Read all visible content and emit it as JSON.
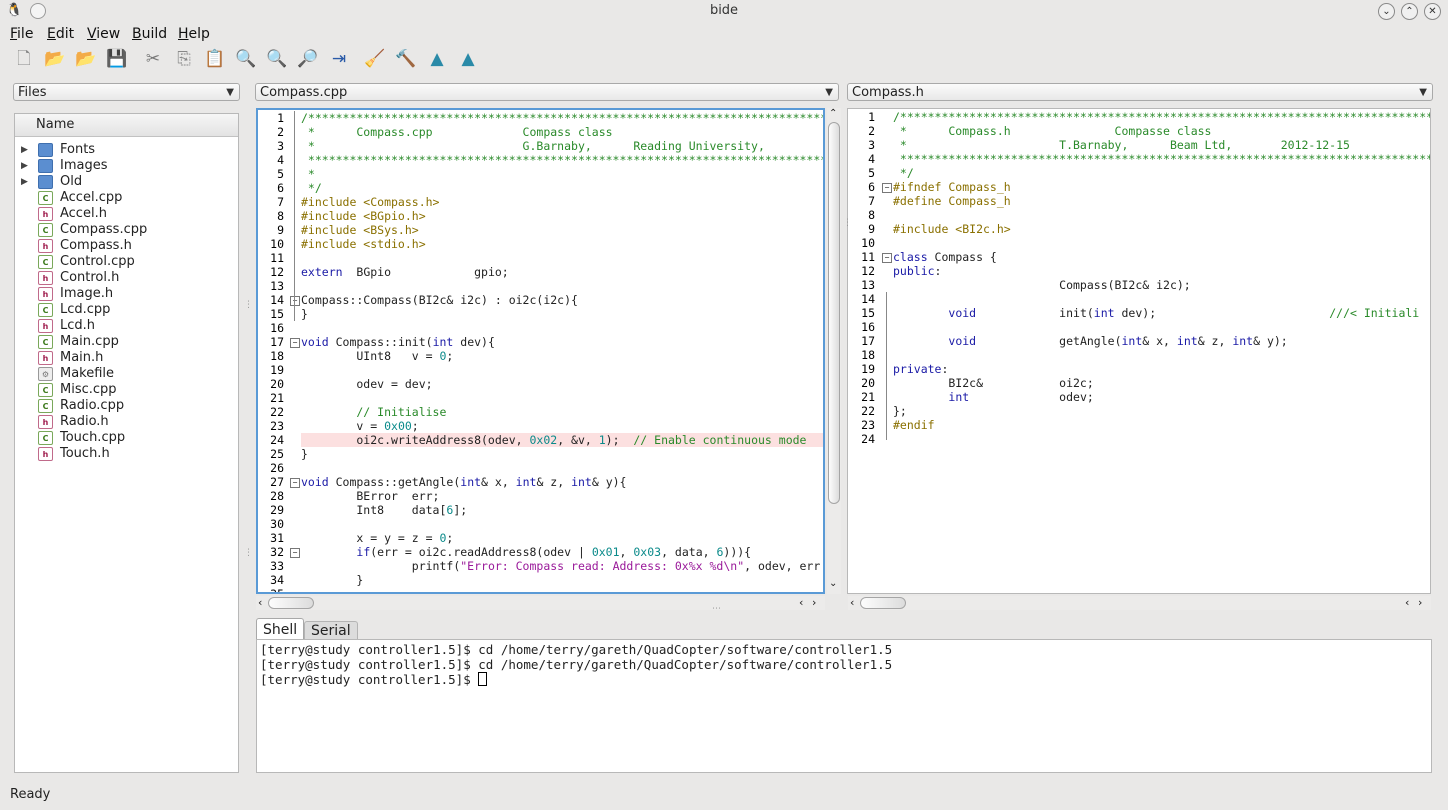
{
  "window": {
    "title": "bide"
  },
  "menu": [
    {
      "label": "File",
      "underline": "F",
      "rest": "ile"
    },
    {
      "label": "Edit",
      "underline": "E",
      "rest": "dit"
    },
    {
      "label": "View",
      "underline": "V",
      "rest": "iew"
    },
    {
      "label": "Build",
      "underline": "B",
      "rest": "uild"
    },
    {
      "label": "Help",
      "underline": "H",
      "rest": "elp"
    }
  ],
  "toolbar": [
    {
      "name": "new-file-icon",
      "glyph": "🗋"
    },
    {
      "name": "open-file-icon",
      "glyph": "📂"
    },
    {
      "name": "open-project-icon",
      "glyph": "📂"
    },
    {
      "name": "save-icon",
      "glyph": "💾"
    },
    {
      "name": "cut-icon",
      "glyph": "✂"
    },
    {
      "name": "copy-icon",
      "glyph": "⎘"
    },
    {
      "name": "paste-icon",
      "glyph": "📋"
    },
    {
      "name": "find-icon",
      "glyph": "🔍"
    },
    {
      "name": "find-next-icon",
      "glyph": "🔍"
    },
    {
      "name": "replace-icon",
      "glyph": "🔎"
    },
    {
      "name": "goto-line-icon",
      "glyph": "⇥"
    },
    {
      "name": "clean-icon",
      "glyph": "🧹"
    },
    {
      "name": "build-icon",
      "glyph": "🔨"
    },
    {
      "name": "flash-icon",
      "glyph": "▲"
    },
    {
      "name": "flash-run-icon",
      "glyph": "▲"
    }
  ],
  "sidebar": {
    "combo_label": "Files",
    "header": "Name",
    "items": [
      {
        "label": "Fonts",
        "type": "folder"
      },
      {
        "label": "Images",
        "type": "folder"
      },
      {
        "label": "Old",
        "type": "folder"
      },
      {
        "label": "Accel.cpp",
        "type": "cpp"
      },
      {
        "label": "Accel.h",
        "type": "h"
      },
      {
        "label": "Compass.cpp",
        "type": "cpp"
      },
      {
        "label": "Compass.h",
        "type": "h"
      },
      {
        "label": "Control.cpp",
        "type": "cpp"
      },
      {
        "label": "Control.h",
        "type": "h"
      },
      {
        "label": "Image.h",
        "type": "h"
      },
      {
        "label": "Lcd.cpp",
        "type": "cpp"
      },
      {
        "label": "Lcd.h",
        "type": "h"
      },
      {
        "label": "Main.cpp",
        "type": "cpp"
      },
      {
        "label": "Main.h",
        "type": "h"
      },
      {
        "label": "Makefile",
        "type": "mk"
      },
      {
        "label": "Misc.cpp",
        "type": "cpp"
      },
      {
        "label": "Radio.cpp",
        "type": "cpp"
      },
      {
        "label": "Radio.h",
        "type": "h"
      },
      {
        "label": "Touch.cpp",
        "type": "cpp"
      },
      {
        "label": "Touch.h",
        "type": "h"
      }
    ]
  },
  "editor_left": {
    "file_label": "Compass.cpp",
    "highlight_line": 24,
    "lines": [
      {
        "n": "1",
        "t": [
          [
            "c-com",
            "/*********************************************************************************************"
          ]
        ]
      },
      {
        "n": "2",
        "t": [
          [
            "c-com",
            " *      Compass.cpp             Compass class"
          ]
        ]
      },
      {
        "n": "3",
        "t": [
          [
            "c-com",
            " *                              G.Barnaby,      Reading University,"
          ]
        ]
      },
      {
        "n": "4",
        "t": [
          [
            "c-com",
            " *********************************************************************************************"
          ]
        ]
      },
      {
        "n": "5",
        "t": [
          [
            "c-com",
            " *"
          ]
        ]
      },
      {
        "n": "6",
        "t": [
          [
            "c-com",
            " */"
          ]
        ]
      },
      {
        "n": "7",
        "t": [
          [
            "c-pre",
            "#include <Compass.h>"
          ]
        ]
      },
      {
        "n": "8",
        "t": [
          [
            "c-pre",
            "#include <BGpio.h>"
          ]
        ]
      },
      {
        "n": "9",
        "t": [
          [
            "c-pre",
            "#include <BSys.h>"
          ]
        ]
      },
      {
        "n": "10",
        "t": [
          [
            "c-pre",
            "#include <stdio.h>"
          ]
        ]
      },
      {
        "n": "11",
        "t": []
      },
      {
        "n": "12",
        "t": [
          [
            "c-kw",
            "extern"
          ],
          [
            "",
            "  BGpio            gpio;"
          ]
        ]
      },
      {
        "n": "13",
        "t": []
      },
      {
        "n": "14",
        "fold": "−",
        "t": [
          [
            "",
            "Compass::Compass(BI2c& i2c) : oi2c(i2c){"
          ]
        ]
      },
      {
        "n": "15",
        "t": [
          [
            "",
            "}"
          ]
        ]
      },
      {
        "n": "16",
        "t": []
      },
      {
        "n": "17",
        "fold": "−",
        "t": [
          [
            "c-kw",
            "void"
          ],
          [
            "",
            " Compass::init("
          ],
          [
            "c-kw",
            "int"
          ],
          [
            "",
            " dev){"
          ]
        ]
      },
      {
        "n": "18",
        "t": [
          [
            "",
            "        UInt8   v = "
          ],
          [
            "c-num",
            "0"
          ],
          [
            "",
            ";"
          ]
        ]
      },
      {
        "n": "19",
        "t": []
      },
      {
        "n": "20",
        "t": [
          [
            "",
            "        odev = dev;"
          ]
        ]
      },
      {
        "n": "21",
        "t": []
      },
      {
        "n": "22",
        "t": [
          [
            "c-com",
            "        // Initialise"
          ]
        ]
      },
      {
        "n": "23",
        "t": [
          [
            "",
            "        v = "
          ],
          [
            "c-num",
            "0x00"
          ],
          [
            "",
            ";"
          ]
        ]
      },
      {
        "n": "24",
        "t": [
          [
            "",
            "        oi2c.writeAddress8(odev, "
          ],
          [
            "c-num",
            "0x02"
          ],
          [
            "",
            ", &v, "
          ],
          [
            "c-num",
            "1"
          ],
          [
            "",
            ");  "
          ],
          [
            "c-com",
            "// Enable continuous mode"
          ]
        ]
      },
      {
        "n": "25",
        "t": [
          [
            "",
            "}"
          ]
        ]
      },
      {
        "n": "26",
        "t": []
      },
      {
        "n": "27",
        "fold": "−",
        "t": [
          [
            "c-kw",
            "void"
          ],
          [
            "",
            " Compass::getAngle("
          ],
          [
            "c-kw",
            "int"
          ],
          [
            "",
            "& x, "
          ],
          [
            "c-kw",
            "int"
          ],
          [
            "",
            "& z, "
          ],
          [
            "c-kw",
            "int"
          ],
          [
            "",
            "& y){"
          ]
        ]
      },
      {
        "n": "28",
        "t": [
          [
            "",
            "        BError  err;"
          ]
        ]
      },
      {
        "n": "29",
        "t": [
          [
            "",
            "        Int8    data["
          ],
          [
            "c-num",
            "6"
          ],
          [
            "",
            "];"
          ]
        ]
      },
      {
        "n": "30",
        "t": []
      },
      {
        "n": "31",
        "t": [
          [
            "",
            "        x = y = z = "
          ],
          [
            "c-num",
            "0"
          ],
          [
            "",
            ";"
          ]
        ]
      },
      {
        "n": "32",
        "fold": "−",
        "t": [
          [
            "",
            "        "
          ],
          [
            "c-kw",
            "if"
          ],
          [
            "",
            "(err = oi2c.readAddress8(odev | "
          ],
          [
            "c-num",
            "0x01"
          ],
          [
            "",
            ", "
          ],
          [
            "c-num",
            "0x03"
          ],
          [
            "",
            ", data, "
          ],
          [
            "c-num",
            "6"
          ],
          [
            "",
            "))){"
          ]
        ]
      },
      {
        "n": "33",
        "t": [
          [
            "",
            "                printf("
          ],
          [
            "c-str",
            "\"Error: Compass read: Address: 0x%x %d\\n\""
          ],
          [
            "",
            ", odev, err"
          ]
        ]
      },
      {
        "n": "34",
        "t": [
          [
            "",
            "        }"
          ]
        ]
      },
      {
        "n": "35",
        "t": []
      }
    ]
  },
  "editor_right": {
    "file_label": "Compass.h",
    "lines": [
      {
        "n": "1",
        "t": [
          [
            "c-com",
            "/*********************************************************************************************"
          ]
        ]
      },
      {
        "n": "2",
        "t": [
          [
            "c-com",
            " *      Compass.h               Compasse class"
          ]
        ]
      },
      {
        "n": "3",
        "t": [
          [
            "c-com",
            " *                      T.Barnaby,      Beam Ltd,       2012-12-15"
          ]
        ]
      },
      {
        "n": "4",
        "t": [
          [
            "c-com",
            " *********************************************************************************************"
          ]
        ]
      },
      {
        "n": "5",
        "t": [
          [
            "c-com",
            " */"
          ]
        ]
      },
      {
        "n": "6",
        "fold": "−",
        "t": [
          [
            "c-pre",
            "#ifndef Compass_h"
          ]
        ]
      },
      {
        "n": "7",
        "t": [
          [
            "c-pre",
            "#define Compass_h"
          ]
        ]
      },
      {
        "n": "8",
        "t": []
      },
      {
        "n": "9",
        "t": [
          [
            "c-pre",
            "#include <BI2c.h>"
          ]
        ]
      },
      {
        "n": "10",
        "t": []
      },
      {
        "n": "11",
        "fold": "−",
        "t": [
          [
            "c-kw",
            "class"
          ],
          [
            "",
            " Compass {"
          ]
        ]
      },
      {
        "n": "12",
        "t": [
          [
            "c-kw",
            "public"
          ],
          [
            "",
            ":"
          ]
        ]
      },
      {
        "n": "13",
        "t": [
          [
            "",
            "                        Compass(BI2c& i2c);"
          ]
        ]
      },
      {
        "n": "14",
        "t": []
      },
      {
        "n": "15",
        "t": [
          [
            "",
            "        "
          ],
          [
            "c-kw",
            "void"
          ],
          [
            "",
            "            init("
          ],
          [
            "c-kw",
            "int"
          ],
          [
            "",
            " dev);                         "
          ],
          [
            "c-com",
            "///< Initiali"
          ]
        ]
      },
      {
        "n": "16",
        "t": []
      },
      {
        "n": "17",
        "t": [
          [
            "",
            "        "
          ],
          [
            "c-kw",
            "void"
          ],
          [
            "",
            "            getAngle("
          ],
          [
            "c-kw",
            "int"
          ],
          [
            "",
            "& x, "
          ],
          [
            "c-kw",
            "int"
          ],
          [
            "",
            "& z, "
          ],
          [
            "c-kw",
            "int"
          ],
          [
            "",
            "& y);"
          ]
        ]
      },
      {
        "n": "18",
        "t": []
      },
      {
        "n": "19",
        "t": [
          [
            "c-kw",
            "private"
          ],
          [
            "",
            ":"
          ]
        ]
      },
      {
        "n": "20",
        "t": [
          [
            "",
            "        BI2c&           oi2c;"
          ]
        ]
      },
      {
        "n": "21",
        "t": [
          [
            "",
            "        "
          ],
          [
            "c-kw",
            "int"
          ],
          [
            "",
            "             odev;"
          ]
        ]
      },
      {
        "n": "22",
        "t": [
          [
            "",
            "};"
          ]
        ]
      },
      {
        "n": "23",
        "t": [
          [
            "c-pre",
            "#endif"
          ]
        ]
      },
      {
        "n": "24",
        "t": []
      }
    ]
  },
  "bottom_tabs": [
    "Shell",
    "Serial"
  ],
  "terminal": {
    "lines": [
      "[terry@study controller1.5]$ cd /home/terry/gareth/QuadCopter/software/controller1.5",
      "[terry@study controller1.5]$ cd /home/terry/gareth/QuadCopter/software/controller1.5",
      "[terry@study controller1.5]$ "
    ]
  },
  "status": "Ready"
}
